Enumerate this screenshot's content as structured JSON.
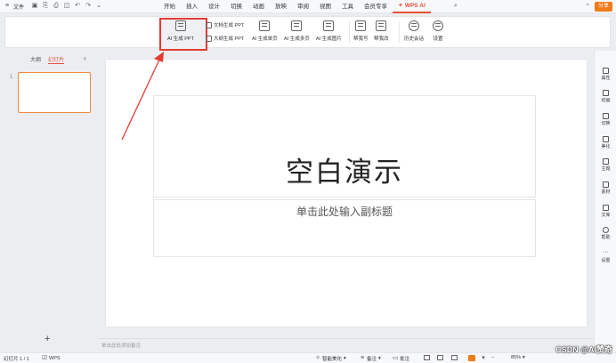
{
  "topbar": {
    "file_label": "文件",
    "menus": [
      "开始",
      "插入",
      "设计",
      "切换",
      "动画",
      "放映",
      "审阅",
      "视图",
      "工具",
      "会员专享"
    ],
    "ai_tab": "WPS AI",
    "share_label": "分享"
  },
  "ribbon": {
    "ai_gen_ppt": "AI 生成 PPT",
    "doc_gen_ppt": "文档生成 PPT",
    "outline_gen_ppt": "大纲生成 PPT",
    "ai_gen_single": "AI 生成单页",
    "ai_gen_multi": "AI 生成多页",
    "ai_gen_image": "AI 生成图片",
    "help_write": "帮我写",
    "help_edit": "帮我改",
    "history": "历史会话",
    "settings": "设置"
  },
  "leftpanel": {
    "tab_outline": "大纲",
    "tab_slides": "幻灯片",
    "slide_number": "1",
    "add": "+"
  },
  "slide": {
    "title": "空白演示",
    "subtitle": "单击此处输入副标题"
  },
  "notes_placeholder": "单击此处添加备注",
  "rightbar": [
    "属性",
    "动画",
    "切换",
    "美化",
    "主题",
    "素材",
    "文库",
    "帮助",
    "设置"
  ],
  "statusbar": {
    "slide_info": "幻灯片 1 / 1",
    "app_name": "WPS",
    "smart_beautify": "智能美化",
    "notes": "备注",
    "comments": "批注",
    "zoom": "85%"
  },
  "watermark": "CSDN @AI赞奇",
  "colors": {
    "accent": "#e9503c",
    "highlight_box": "#e53935",
    "share_button": "#ef7b1a"
  }
}
